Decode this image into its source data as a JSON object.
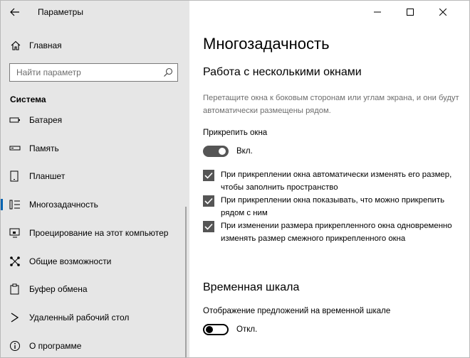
{
  "window": {
    "title": "Параметры"
  },
  "sidebar": {
    "home_label": "Главная",
    "search_placeholder": "Найти параметр",
    "section_title": "Система",
    "items": [
      {
        "label": "Батарея",
        "icon": "battery-icon"
      },
      {
        "label": "Память",
        "icon": "storage-icon"
      },
      {
        "label": "Планшет",
        "icon": "tablet-icon"
      },
      {
        "label": "Многозадачность",
        "icon": "multitasking-icon",
        "selected": true
      },
      {
        "label": "Проецирование на этот компьютер",
        "icon": "projecting-icon"
      },
      {
        "label": "Общие возможности",
        "icon": "shared-experiences-icon"
      },
      {
        "label": "Буфер обмена",
        "icon": "clipboard-icon"
      },
      {
        "label": "Удаленный рабочий стол",
        "icon": "remote-desktop-icon"
      },
      {
        "label": "О программе",
        "icon": "info-icon"
      }
    ]
  },
  "main": {
    "title": "Многозадачность",
    "snap": {
      "heading": "Работа с несколькими окнами",
      "description": "Перетащите окна к боковым сторонам или углам экрана, и они будут автоматически размещены рядом.",
      "toggle_label": "Прикрепить окна",
      "toggle_state": "Вкл.",
      "toggle_on": true,
      "options": [
        {
          "text": "При прикреплении окна автоматически изменять его размер, чтобы заполнить пространство",
          "checked": true
        },
        {
          "text": "При прикреплении окна показывать, что можно прикрепить рядом с ним",
          "checked": true
        },
        {
          "text": "При изменении размера прикрепленного окна одновременно изменять размер смежного прикрепленного окна",
          "checked": true
        }
      ]
    },
    "timeline": {
      "heading": "Временная шкала",
      "toggle_label": "Отображение предложений на временной шкале",
      "toggle_state": "Откл.",
      "toggle_on": false
    }
  },
  "colors": {
    "sidebar_bg": "#e6e6e6",
    "accent": "#0063b1",
    "toggle_on": "#555555"
  }
}
